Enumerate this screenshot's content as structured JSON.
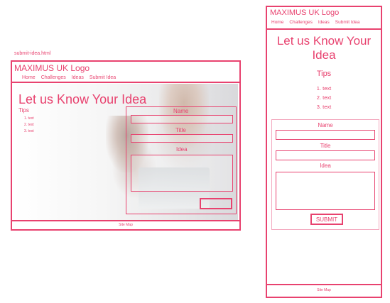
{
  "filename": "submit-idea.html",
  "desktop": {
    "logo": "MAXIMUS UK Logo",
    "nav": [
      "Home",
      "Challenges",
      "Ideas",
      "Submit Idea"
    ],
    "title": "Let us Know Your Idea",
    "tips_heading": "Tips",
    "tips": [
      "1. text",
      "2. text",
      "3. text"
    ],
    "form": {
      "name_label": "Name",
      "title_label": "Title",
      "idea_label": "Idea",
      "submit_label": ""
    },
    "footer": "Site Map"
  },
  "mobile": {
    "logo": "MAXIMUS UK Logo",
    "nav": [
      "Home",
      "Challenges",
      "Ideas",
      "Submit Idea"
    ],
    "title": "Let us Know Your Idea",
    "tips_heading": "Tips",
    "tips": [
      "1. text",
      "2. text",
      "3. text"
    ],
    "form": {
      "name_label": "Name",
      "title_label": "Title",
      "idea_label": "Idea",
      "submit_label": "SUBMIT"
    },
    "footer": "Site Map"
  },
  "colors": {
    "accent": "#e8426f",
    "form_border_light": "#f3a6bd"
  }
}
